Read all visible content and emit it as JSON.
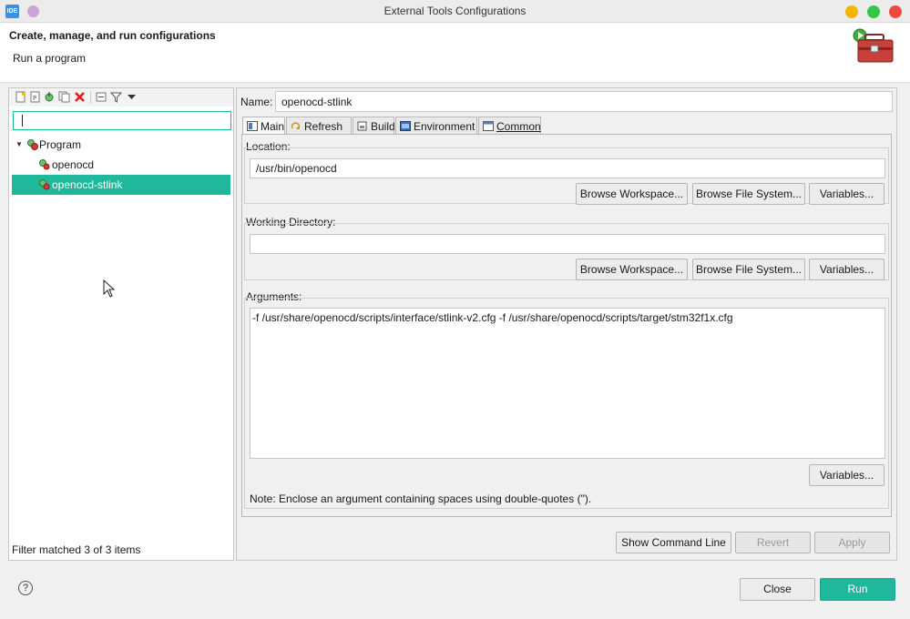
{
  "window": {
    "title": "External Tools Configurations",
    "ide_badge": "IDE"
  },
  "header": {
    "title": "Create, manage, and run configurations",
    "subtitle": "Run a program"
  },
  "left": {
    "filter": {
      "value": "",
      "placeholder": ""
    },
    "tree": {
      "root": "Program",
      "children": [
        "openocd",
        "openocd-stlink"
      ],
      "selected": "openocd-stlink"
    },
    "status": "Filter matched 3 of 3 items"
  },
  "config": {
    "name_label": "Name:",
    "name_value": "openocd-stlink",
    "tabs": [
      "Main",
      "Refresh",
      "Build",
      "Environment",
      "Common"
    ],
    "active_tab": "Main",
    "location": {
      "label": "Location:",
      "value": "/usr/bin/openocd",
      "buttons": [
        "Browse Workspace...",
        "Browse File System...",
        "Variables..."
      ]
    },
    "working_dir": {
      "label": "Working Directory:",
      "value": "",
      "buttons": [
        "Browse Workspace...",
        "Browse File System...",
        "Variables..."
      ]
    },
    "arguments": {
      "label": "Arguments:",
      "value": "-f /usr/share/openocd/scripts/interface/stlink-v2.cfg -f /usr/share/openocd/scripts/target/stm32f1x.cfg",
      "variables_button": "Variables...",
      "note": "Note: Enclose an argument containing spaces using double-quotes (\")."
    },
    "actions": {
      "show_command_line": "Show Command Line",
      "revert": "Revert",
      "apply": "Apply"
    }
  },
  "footer": {
    "help": "?",
    "close": "Close",
    "run": "Run"
  },
  "colors": {
    "accent": "#1fb89a",
    "window_bg": "#f0f0f0",
    "close_dot": "#ee4b3f",
    "max_dot": "#33c748",
    "min_dot": "#f5b400"
  },
  "icons": {
    "tree_program": "program-folder-icon",
    "tree_item": "external-tool-icon",
    "toolbox": "toolbox-run-icon"
  }
}
